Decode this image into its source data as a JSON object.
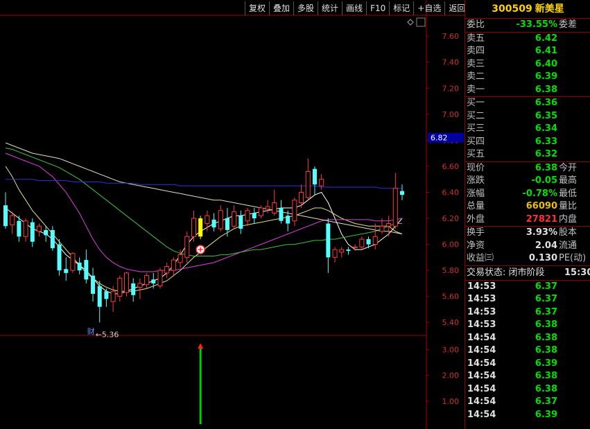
{
  "toolbar": [
    "复权",
    "叠加",
    "多股",
    "统计",
    "画线",
    "F10",
    "标记",
    "+自选",
    "返回"
  ],
  "stock": {
    "code": "300509",
    "name": "新美星"
  },
  "panel": {
    "weibi": {
      "label": "委比",
      "value": "-33.55%",
      "label2": "委差"
    },
    "asks": [
      {
        "label": "卖五",
        "price": "6.42"
      },
      {
        "label": "卖四",
        "price": "6.41"
      },
      {
        "label": "卖三",
        "price": "6.40"
      },
      {
        "label": "卖二",
        "price": "6.39"
      },
      {
        "label": "卖一",
        "price": "6.38"
      }
    ],
    "bids": [
      {
        "label": "买一",
        "price": "6.36"
      },
      {
        "label": "买二",
        "price": "6.35"
      },
      {
        "label": "买三",
        "price": "6.34"
      },
      {
        "label": "买四",
        "price": "6.33"
      },
      {
        "label": "买五",
        "price": "6.32"
      }
    ],
    "stats": [
      {
        "label": "现价",
        "value": "6.38",
        "color": "green",
        "label2": "今开"
      },
      {
        "label": "涨跌",
        "value": "-0.05",
        "color": "green",
        "label2": "最高"
      },
      {
        "label": "涨幅",
        "value": "-0.78%",
        "color": "green",
        "label2": "最低"
      },
      {
        "label": "总量",
        "value": "66090",
        "color": "gold",
        "label2": "量比"
      },
      {
        "label": "外盘",
        "value": "27821",
        "color": "red",
        "label2": "内盘"
      }
    ],
    "fund": [
      {
        "label": "换手",
        "value": "3.93%",
        "label2": "股本"
      },
      {
        "label": "净资",
        "value": "2.04",
        "label2": "流通"
      },
      {
        "label": "收益㈢",
        "value": "0.130",
        "label2": "PE(动)"
      }
    ],
    "status": {
      "label": "交易状态: 闭市阶段",
      "time": "15:30:"
    },
    "ticks": [
      {
        "time": "14:53",
        "price": "6.37"
      },
      {
        "time": "14:53",
        "price": "6.37"
      },
      {
        "time": "14:53",
        "price": "6.37"
      },
      {
        "time": "14:53",
        "price": "6.38"
      },
      {
        "time": "14:54",
        "price": "6.38"
      },
      {
        "time": "14:54",
        "price": "6.38"
      },
      {
        "time": "14:54",
        "price": "6.39"
      },
      {
        "time": "14:54",
        "price": "6.38"
      },
      {
        "time": "14:54",
        "price": "6.38"
      },
      {
        "time": "14:54",
        "price": "6.37"
      },
      {
        "time": "14:54",
        "price": "6.39"
      }
    ]
  },
  "chart_data": {
    "type": "candlestick",
    "price_axis": {
      "ylim": [
        5.3,
        7.75
      ],
      "ticks": [
        "7.60",
        "7.40",
        "7.20",
        "7.00",
        "6.80",
        "6.60",
        "6.40",
        "6.20",
        "6.00",
        "5.80",
        "5.60",
        "5.40"
      ]
    },
    "current_price_label": "6.82",
    "current_price": 6.82,
    "low_annotation": {
      "text": "←5.36",
      "value": 5.36,
      "index": 14
    },
    "finance_marker": {
      "text": "财",
      "index": 14
    },
    "candles": [
      {
        "o": 6.3,
        "c": 6.14,
        "h": 6.4,
        "l": 6.12
      },
      {
        "o": 6.15,
        "c": 6.22,
        "h": 6.25,
        "l": 6.08
      },
      {
        "o": 6.18,
        "c": 6.06,
        "h": 6.22,
        "l": 6.02
      },
      {
        "o": 6.06,
        "c": 6.18,
        "h": 6.2,
        "l": 6.02
      },
      {
        "o": 6.17,
        "c": 6.02,
        "h": 6.2,
        "l": 5.98
      },
      {
        "o": 6.1,
        "c": 6.14,
        "h": 6.16,
        "l": 6.06
      },
      {
        "o": 6.11,
        "c": 6.07,
        "h": 6.14,
        "l": 6.02
      },
      {
        "o": 6.11,
        "c": 5.97,
        "h": 6.14,
        "l": 5.95
      },
      {
        "o": 6.0,
        "c": 5.8,
        "h": 6.04,
        "l": 5.76
      },
      {
        "o": 5.81,
        "c": 5.78,
        "h": 5.9,
        "l": 5.72
      },
      {
        "o": 5.8,
        "c": 5.93,
        "h": 5.94,
        "l": 5.78
      },
      {
        "o": 5.86,
        "c": 5.8,
        "h": 5.9,
        "l": 5.77
      },
      {
        "o": 5.88,
        "c": 5.73,
        "h": 5.96,
        "l": 5.7
      },
      {
        "o": 5.76,
        "c": 5.62,
        "h": 5.82,
        "l": 5.56
      },
      {
        "o": 5.68,
        "c": 5.52,
        "h": 5.72,
        "l": 5.4
      },
      {
        "o": 5.64,
        "c": 5.58,
        "h": 5.66,
        "l": 5.52
      },
      {
        "o": 5.56,
        "c": 5.64,
        "h": 5.68,
        "l": 5.48
      },
      {
        "o": 5.6,
        "c": 5.74,
        "h": 5.76,
        "l": 5.56
      },
      {
        "o": 5.63,
        "c": 5.78,
        "h": 5.79,
        "l": 5.6
      },
      {
        "o": 5.7,
        "c": 5.61,
        "h": 5.74,
        "l": 5.56
      },
      {
        "o": 5.67,
        "c": 5.7,
        "h": 5.74,
        "l": 5.58
      },
      {
        "o": 5.69,
        "c": 5.76,
        "h": 5.78,
        "l": 5.66
      },
      {
        "o": 5.73,
        "c": 5.7,
        "h": 5.78,
        "l": 5.66
      },
      {
        "o": 5.68,
        "c": 5.8,
        "h": 5.82,
        "l": 5.66
      },
      {
        "o": 5.78,
        "c": 5.83,
        "h": 5.86,
        "l": 5.74
      },
      {
        "o": 5.8,
        "c": 5.88,
        "h": 5.9,
        "l": 5.76
      },
      {
        "o": 5.86,
        "c": 5.92,
        "h": 5.96,
        "l": 5.82
      },
      {
        "o": 5.9,
        "c": 6.06,
        "h": 6.1,
        "l": 5.86
      },
      {
        "o": 6.06,
        "c": 6.2,
        "h": 6.26,
        "l": 6.02
      },
      {
        "o": 6.06,
        "c": 6.2,
        "h": 6.22,
        "l": 6.04,
        "special": "yellow"
      },
      {
        "o": 6.16,
        "c": 6.22,
        "h": 6.26,
        "l": 6.1
      },
      {
        "o": 6.19,
        "c": 6.13,
        "h": 6.24,
        "l": 6.1
      },
      {
        "o": 6.12,
        "c": 6.26,
        "h": 6.3,
        "l": 6.1
      },
      {
        "o": 6.2,
        "c": 6.11,
        "h": 6.28,
        "l": 6.06
      },
      {
        "o": 6.14,
        "c": 6.25,
        "h": 6.3,
        "l": 6.12
      },
      {
        "o": 6.22,
        "c": 6.12,
        "h": 6.26,
        "l": 6.08
      },
      {
        "o": 6.18,
        "c": 6.26,
        "h": 6.28,
        "l": 6.14
      },
      {
        "o": 6.24,
        "c": 6.2,
        "h": 6.28,
        "l": 6.16
      },
      {
        "o": 6.22,
        "c": 6.28,
        "h": 6.3,
        "l": 6.2
      },
      {
        "o": 6.27,
        "c": 6.29,
        "h": 6.34,
        "l": 6.24
      },
      {
        "o": 6.24,
        "c": 6.32,
        "h": 6.42,
        "l": 6.22
      },
      {
        "o": 6.28,
        "c": 6.18,
        "h": 6.34,
        "l": 6.16
      },
      {
        "o": 6.22,
        "c": 6.16,
        "h": 6.26,
        "l": 6.1
      },
      {
        "o": 6.18,
        "c": 6.34,
        "h": 6.36,
        "l": 6.14
      },
      {
        "o": 6.32,
        "c": 6.4,
        "h": 6.46,
        "l": 6.28
      },
      {
        "o": 6.36,
        "c": 6.56,
        "h": 6.66,
        "l": 6.34
      },
      {
        "o": 6.58,
        "c": 6.46,
        "h": 6.6,
        "l": 6.38
      },
      {
        "o": 6.45,
        "c": 6.5,
        "h": 6.54,
        "l": 6.42
      },
      {
        "o": 6.16,
        "c": 5.9,
        "h": 6.2,
        "l": 5.78
      },
      {
        "o": 5.9,
        "c": 5.96,
        "h": 5.98,
        "l": 5.86
      },
      {
        "o": 5.94,
        "c": 5.96,
        "h": 5.98,
        "l": 5.9
      },
      {
        "o": 5.96,
        "c": 5.95,
        "h": 5.98,
        "l": 5.92
      },
      {
        "o": 5.98,
        "c": 5.98,
        "h": 6.0,
        "l": 5.95
      },
      {
        "o": 5.98,
        "c": 6.04,
        "h": 6.06,
        "l": 5.96
      },
      {
        "o": 6.04,
        "c": 6.0,
        "h": 6.06,
        "l": 5.97
      },
      {
        "o": 6.0,
        "c": 6.06,
        "h": 6.16,
        "l": 5.96
      },
      {
        "o": 6.1,
        "c": 6.14,
        "h": 6.2,
        "l": 6.08
      },
      {
        "o": 6.14,
        "c": 6.16,
        "h": 6.22,
        "l": 6.06
      },
      {
        "o": 6.14,
        "c": 6.43,
        "h": 6.55,
        "l": 6.12
      },
      {
        "o": 6.41,
        "c": 6.38,
        "h": 6.46,
        "l": 6.34
      }
    ],
    "ma_lines": [
      {
        "color": "#ffffff",
        "values": [
          6.28,
          6.24,
          6.2,
          6.16,
          6.12,
          6.1,
          6.08,
          6.04,
          5.98,
          5.92,
          5.88,
          5.84,
          5.8,
          5.74,
          5.68,
          5.64,
          5.62,
          5.62,
          5.64,
          5.66,
          5.68,
          5.7,
          5.72,
          5.74,
          5.78,
          5.84,
          5.92,
          6.0,
          6.06,
          6.1,
          6.13,
          6.16,
          6.18,
          6.2,
          6.22,
          6.22,
          6.23,
          6.24,
          6.25,
          6.26,
          6.27,
          6.28,
          6.28,
          6.28,
          6.3,
          6.34,
          6.38,
          6.4,
          6.32,
          6.2,
          6.08,
          6.0,
          5.96,
          5.96,
          5.98,
          6.0,
          6.04,
          6.08,
          6.14,
          6.2
        ]
      },
      {
        "color": "#e8e080",
        "values": [
          6.6,
          6.52,
          6.42,
          6.34,
          6.26,
          6.2,
          6.14,
          6.08,
          6.02,
          5.96,
          5.9,
          5.84,
          5.78,
          5.74,
          5.7,
          5.67,
          5.65,
          5.64,
          5.64,
          5.64,
          5.65,
          5.66,
          5.68,
          5.7,
          5.72,
          5.76,
          5.8,
          5.85,
          5.9,
          5.94,
          5.98,
          6.02,
          6.06,
          6.09,
          6.12,
          6.14,
          6.15,
          6.16,
          6.17,
          6.18,
          6.19,
          6.2,
          6.21,
          6.22,
          6.24,
          6.26,
          6.28,
          6.28,
          6.26,
          6.23,
          6.2,
          6.18,
          6.16,
          6.15,
          6.14,
          6.14,
          6.14,
          6.14,
          6.1,
          6.08
        ]
      },
      {
        "color": "#e040e0",
        "values": [
          6.7,
          6.68,
          6.66,
          6.64,
          6.62,
          6.6,
          6.56,
          6.52,
          6.46,
          6.4,
          6.32,
          6.24,
          6.14,
          6.04,
          5.96,
          5.9,
          5.86,
          5.83,
          5.81,
          5.8,
          5.79,
          5.79,
          5.79,
          5.8,
          5.8,
          5.8,
          5.81,
          5.82,
          5.83,
          5.84,
          5.85,
          5.86,
          5.88,
          5.9,
          5.92,
          5.94,
          5.96,
          5.98,
          6.0,
          6.02,
          6.04,
          6.06,
          6.08,
          6.1,
          6.12,
          6.14,
          6.16,
          6.18,
          6.19,
          6.19,
          6.19,
          6.19,
          6.19,
          6.19,
          6.19,
          6.18,
          6.18,
          6.18,
          6.19,
          6.2
        ]
      },
      {
        "color": "#40c040",
        "values": [
          6.74,
          6.73,
          6.71,
          6.69,
          6.67,
          6.65,
          6.63,
          6.61,
          6.59,
          6.56,
          6.53,
          6.5,
          6.46,
          6.42,
          6.38,
          6.34,
          6.3,
          6.26,
          6.22,
          6.18,
          6.14,
          6.1,
          6.06,
          6.02,
          5.98,
          5.95,
          5.93,
          5.92,
          5.91,
          5.91,
          5.91,
          5.91,
          5.92,
          5.92,
          5.93,
          5.94,
          5.95,
          5.96,
          5.96,
          5.97,
          5.98,
          5.99,
          6.0,
          6.0,
          6.01,
          6.02,
          6.03,
          6.03,
          6.04,
          6.04,
          6.05,
          6.06,
          6.07,
          6.08,
          6.09,
          6.1,
          6.12,
          6.14,
          6.16,
          6.16
        ]
      },
      {
        "color": "#e0e0c0",
        "values": [
          6.78,
          6.76,
          6.74,
          6.72,
          6.7,
          6.69,
          6.68,
          6.67,
          6.66,
          6.64,
          6.62,
          6.6,
          6.58,
          6.56,
          6.54,
          6.52,
          6.5,
          6.48,
          6.47,
          6.46,
          6.45,
          6.44,
          6.43,
          6.42,
          6.41,
          6.4,
          6.39,
          6.38,
          6.37,
          6.36,
          6.35,
          6.34,
          6.34,
          6.33,
          6.32,
          6.31,
          6.3,
          6.29,
          6.28,
          6.27,
          6.26,
          6.25,
          6.24,
          6.23,
          6.22,
          6.21,
          6.2,
          6.19,
          6.18,
          6.17,
          6.16,
          6.15,
          6.14,
          6.13,
          6.12,
          6.11,
          6.1,
          6.1,
          6.09,
          6.08
        ]
      },
      {
        "color": "#3030e0",
        "values": [
          6.5,
          6.5,
          6.5,
          6.5,
          6.5,
          6.49,
          6.49,
          6.49,
          6.49,
          6.49,
          6.48,
          6.48,
          6.48,
          6.48,
          6.48,
          6.47,
          6.47,
          6.47,
          6.47,
          6.47,
          6.46,
          6.46,
          6.46,
          6.46,
          6.46,
          6.46,
          6.45,
          6.45,
          6.45,
          6.45,
          6.45,
          6.45,
          6.45,
          6.45,
          6.45,
          6.45,
          6.45,
          6.45,
          6.45,
          6.45,
          6.45,
          6.45,
          6.45,
          6.45,
          6.45,
          6.45,
          6.45,
          6.44,
          6.44,
          6.44,
          6.44,
          6.44,
          6.44,
          6.44,
          6.44,
          6.44,
          6.43,
          6.43,
          6.43,
          6.43
        ]
      }
    ],
    "indicator": {
      "ylim": [
        0,
        3.5
      ],
      "ticks": [
        "3.00",
        "2.00",
        "1.00"
      ],
      "signal_index": 29,
      "signal_value": 3.2
    }
  }
}
